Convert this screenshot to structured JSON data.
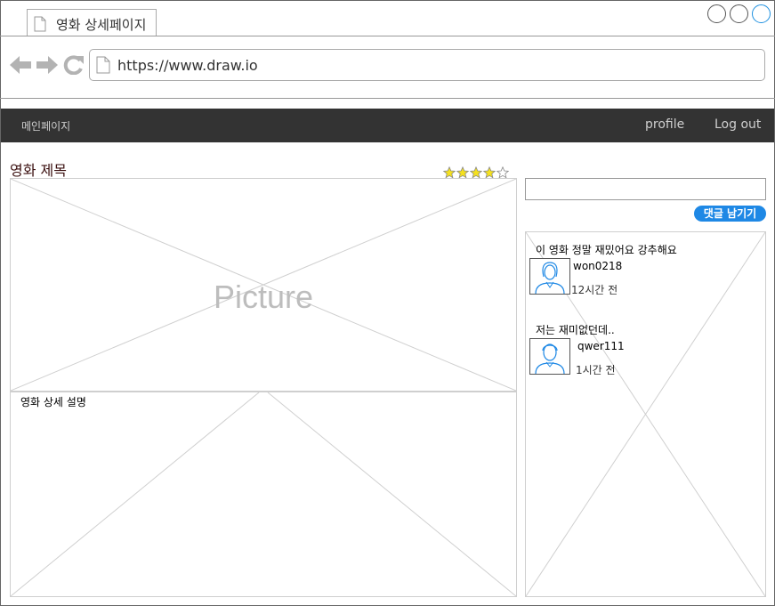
{
  "browser": {
    "tab_title": "영화 상세페이지",
    "url": "https://www.draw.io"
  },
  "navbar": {
    "home": "메인페이지",
    "profile": "profile",
    "logout": "Log out"
  },
  "movie": {
    "title": "영화 제목",
    "rating": {
      "filled": 4,
      "total": 5
    },
    "picture_label": "Picture",
    "description_label": "영화 상세 설명"
  },
  "comment_form": {
    "input_value": "",
    "submit_label": "댓글 남기기"
  },
  "comments": [
    {
      "text": "이 영화 정말 재밌어요 강추해요",
      "user": "won0218",
      "time": "12시간 전"
    },
    {
      "text": "저는 재미없던데..",
      "user": "qwer111",
      "time": "1시간 전"
    }
  ],
  "colors": {
    "navbar_bg": "#333333",
    "accent": "#1e88e5",
    "star_fill": "#f5e11e"
  }
}
